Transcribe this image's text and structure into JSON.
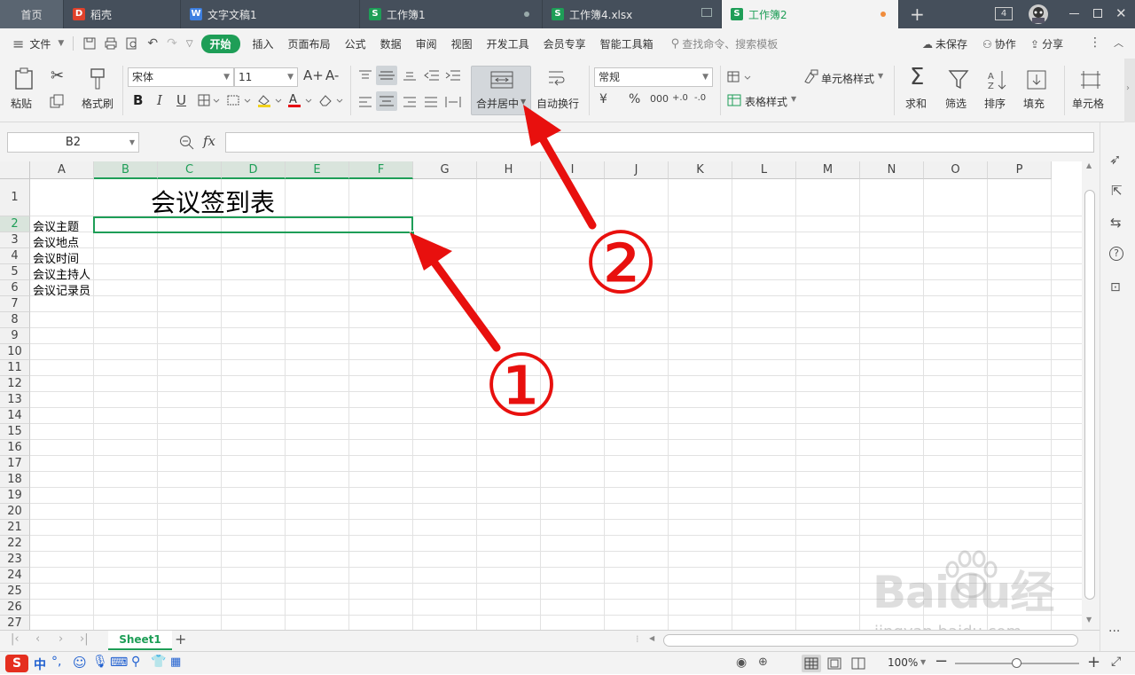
{
  "tabs": [
    {
      "label": "首页"
    },
    {
      "label": "稻壳"
    },
    {
      "label": "文字文稿1"
    },
    {
      "label": "工作簿1"
    },
    {
      "label": "工作簿4.xlsx"
    },
    {
      "label": "工作簿2"
    }
  ],
  "tab_counter": "4",
  "menu": {
    "file": "文件",
    "items": [
      "开始",
      "插入",
      "页面布局",
      "公式",
      "数据",
      "审阅",
      "视图",
      "开发工具",
      "会员专享",
      "智能工具箱"
    ],
    "search_placeholder": "查找命令、搜索模板",
    "unsaved": "未保存",
    "collab": "协作",
    "share": "分享"
  },
  "ribbon": {
    "paste": "粘贴",
    "format_painter": "格式刷",
    "font_name": "宋体",
    "font_size": "11",
    "merge_center": "合并居中",
    "wrap_text": "自动换行",
    "number_format": "常规",
    "cell_style": "单元格样式",
    "table_style": "表格样式",
    "sum": "求和",
    "filter": "筛选",
    "sort": "排序",
    "fill": "填充",
    "cell": "单元格",
    "grow_font": "A+",
    "shrink_font": "A-",
    "bold": "B",
    "italic": "I",
    "underline": "U",
    "currency": "¥",
    "percent": "%",
    "thousands": "000",
    "inc_dec": "+.0",
    "dec_dec": "-.0"
  },
  "formula_bar": {
    "name_box": "B2",
    "fx": "fx",
    "value": ""
  },
  "grid": {
    "columns": [
      "A",
      "B",
      "C",
      "D",
      "E",
      "F",
      "G",
      "H",
      "I",
      "J",
      "K",
      "L",
      "M",
      "N",
      "O",
      "P"
    ],
    "rows": [
      "1",
      "2",
      "3",
      "4",
      "5",
      "6",
      "7",
      "8",
      "9",
      "10",
      "11",
      "12",
      "13",
      "14",
      "15",
      "16",
      "17",
      "18",
      "19",
      "20",
      "21",
      "22",
      "23",
      "24",
      "25",
      "26",
      "27"
    ],
    "title": "会议签到表",
    "labels": [
      "会议主题",
      "会议地点",
      "会议时间",
      "会议主持人",
      "会议记录员"
    ],
    "selected_cell": "B2"
  },
  "annotations": {
    "circle1": "①",
    "circle2": "②",
    "color": "#e8100e"
  },
  "sheet_tabs": [
    "Sheet1"
  ],
  "status": {
    "zoom": "100%",
    "input_lang": "中"
  },
  "watermark": {
    "brand": "Baidu经验",
    "url": "jingyan.baidu.com"
  },
  "colors": {
    "accent": "#1e9e57",
    "tabbar": "#454f5b",
    "selection": "#1e9e57"
  }
}
